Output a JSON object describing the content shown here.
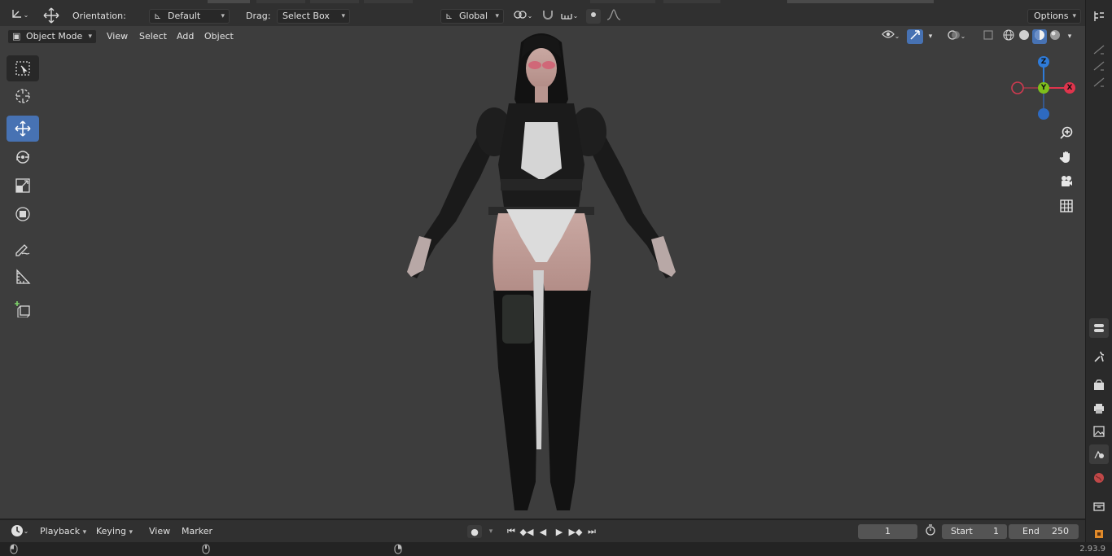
{
  "tool_settings": {
    "orientation_label": "Orientation:",
    "orientation_value": "Default",
    "drag_label": "Drag:",
    "drag_value": "Select Box",
    "transform_space": "Global",
    "options_label": "Options"
  },
  "viewport_header": {
    "mode": "Object Mode",
    "menus": [
      "View",
      "Select",
      "Add",
      "Object"
    ]
  },
  "gizmo": {
    "z": "Z",
    "y": "Y",
    "x": "X",
    "colors": {
      "x": "#e0344c",
      "y": "#7ebf1c",
      "z": "#2e7bd9"
    }
  },
  "timeline": {
    "menus": [
      "Playback",
      "Keying",
      "View",
      "Marker"
    ],
    "current_frame": "1",
    "start_label": "Start",
    "start_value": "1",
    "end_label": "End",
    "end_value": "250"
  },
  "status": {
    "version": "2.93.9"
  },
  "colors": {
    "accent": "#4772b3",
    "viewport_bg": "#3d3d3d",
    "header_bg": "#303030"
  }
}
